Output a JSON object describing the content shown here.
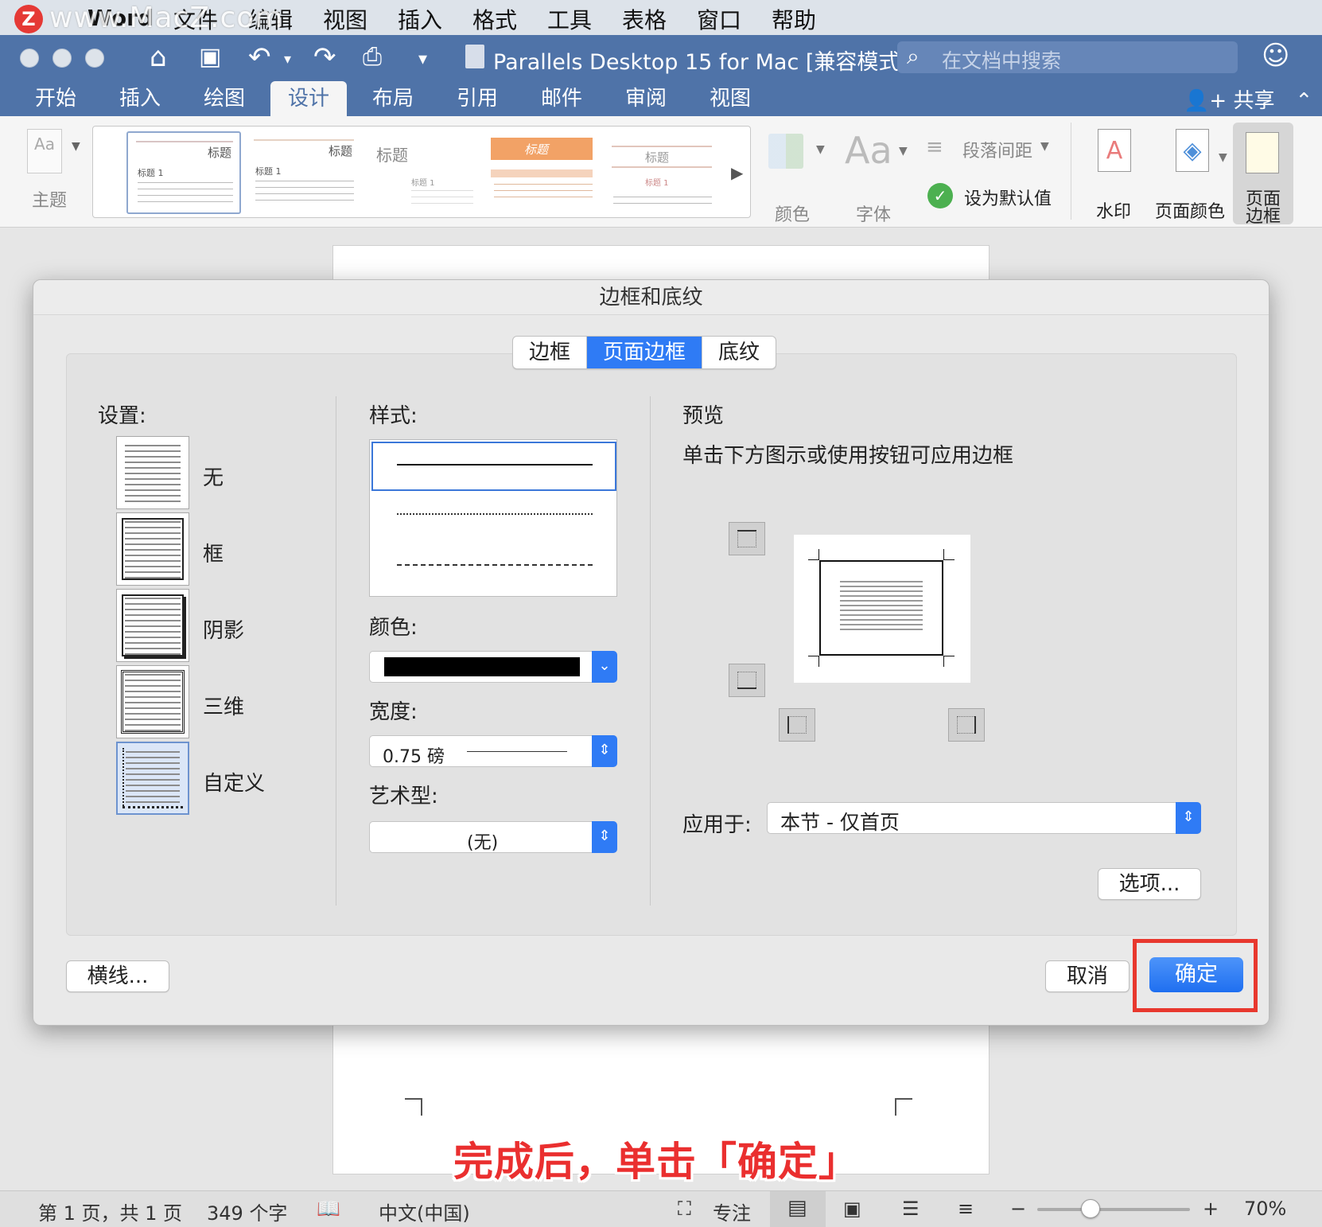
{
  "menubar": {
    "logo": "Z",
    "watermark": "www.MacZ.com",
    "app": "Word",
    "items": [
      "文件",
      "编辑",
      "视图",
      "插入",
      "格式",
      "工具",
      "表格",
      "窗口",
      "帮助"
    ]
  },
  "titlebar": {
    "title": "Parallels Desktop 15 for Mac [兼容模式]",
    "search_placeholder": "在文档中搜索"
  },
  "ribbon_tabs": [
    "开始",
    "插入",
    "绘图",
    "设计",
    "布局",
    "引用",
    "邮件",
    "审阅",
    "视图"
  ],
  "active_tab": "设计",
  "share_label": "共享",
  "ribbon": {
    "theme_label": "主题",
    "gallery_heading": "标题",
    "gallery_sub": "标题 1",
    "gallery_highlight": "标题",
    "colors_label": "颜色",
    "fonts_label": "字体",
    "fonts_glyph": "Aa",
    "theme_glyph": "Aa",
    "para_spacing_label": "段落间距",
    "set_default_label": "设为默认值",
    "watermark_label": "水印",
    "page_color_label": "页面颜色",
    "page_border_label_1": "页面",
    "page_border_label_2": "边框"
  },
  "dialog": {
    "title": "边框和底纹",
    "tabs": [
      "边框",
      "页面边框",
      "底纹"
    ],
    "active_tab": "页面边框",
    "settings_label": "设置:",
    "settings": [
      "无",
      "框",
      "阴影",
      "三维",
      "自定义"
    ],
    "selected_setting": "自定义",
    "style_label": "样式:",
    "color_label": "颜色:",
    "color_value": "#000000",
    "width_label": "宽度:",
    "width_value": "0.75 磅",
    "art_label": "艺术型:",
    "art_value": "(无)",
    "preview_label": "预览",
    "preview_hint": "单击下方图示或使用按钮可应用边框",
    "apply_label": "应用于:",
    "apply_value": "本节 - 仅首页",
    "options_button": "选项...",
    "hline_button": "横线...",
    "cancel_button": "取消",
    "ok_button": "确定"
  },
  "annotation": "完成后，单击「确定」",
  "statusbar": {
    "page": "第 1 页，共 1 页",
    "words": "349 个字",
    "language": "中文(中国)",
    "focus": "专注",
    "zoom": "70%",
    "zoom_level": 0.35
  },
  "colors": {
    "accent_blue": "#4f73a8",
    "button_blue": "#2f7bf5",
    "highlight_red": "#e8382e"
  }
}
